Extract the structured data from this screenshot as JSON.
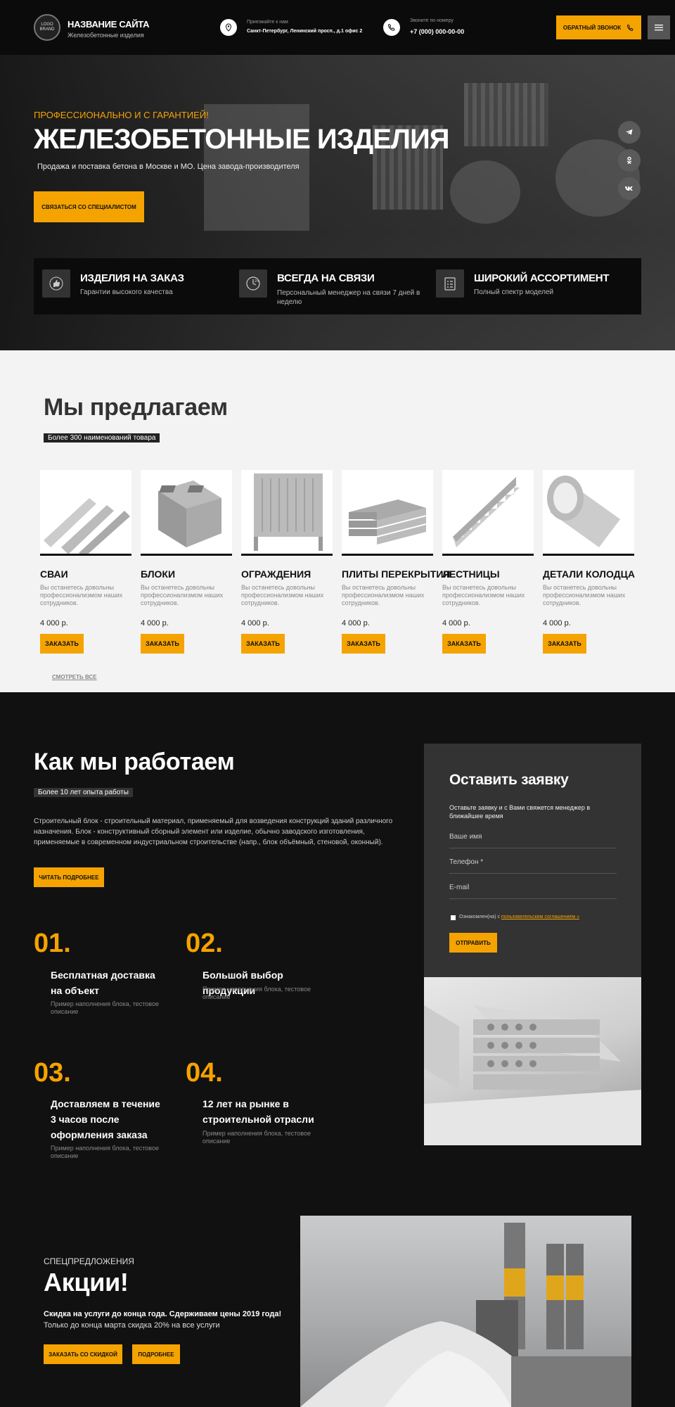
{
  "header": {
    "logo_line1": "LOGO",
    "logo_line2": "BRAND",
    "site_name": "НАЗВАНИЕ САЙТА",
    "site_subtitle": "Железобетонные изделия",
    "address_label": "Приезжайте к нам",
    "address": "Санкт-Петербург, Ленинский просп., д.1 офис 2",
    "phone_label": "Звоните по номеру",
    "phone": "+7 (000) 000-00-00",
    "callback_button": "ОБРАТНЫЙ ЗВОНОК",
    "icons": [
      "map-pin-icon",
      "phone-icon",
      "menu-icon"
    ]
  },
  "hero": {
    "eyebrow": "ПРОФЕССИОНАЛЬНО И С ГАРАНТИЕЙ!",
    "title": "ЖЕЛЕЗОБЕТОННЫЕ ИЗДЕЛИЯ",
    "subtitle": "Продажа и поставка бетона в Москве и МО. Цена завода-производителя",
    "cta": "СВЯЗАТЬСЯ СО СПЕЦИАЛИСТОМ",
    "social": [
      "telegram-icon",
      "odnoklassniki-icon",
      "vk-icon"
    ],
    "features": [
      {
        "title": "ИЗДЕЛИЯ НА ЗАКАЗ",
        "desc": "Гарантии высокого качества",
        "icon": "thumbs-up-icon"
      },
      {
        "title": "ВСЕГДА НА СВЯЗИ",
        "desc": "Персональный менеджер на связи 7 дней в неделю",
        "icon": "clock-24-icon"
      },
      {
        "title": "ШИРОКИЙ АССОРТИМЕНТ",
        "desc": "Полный спектр моделей",
        "icon": "checklist-icon"
      }
    ]
  },
  "offer": {
    "title": "Мы предлагаем",
    "badge": "Более 300 наименований товара",
    "products": [
      {
        "name": "СВАИ",
        "desc": "Вы останетесь довольны профессионализмом наших сотрудников.",
        "price": "4 000 р.",
        "button": "ЗАКАЗАТЬ"
      },
      {
        "name": "БЛОКИ",
        "desc": "Вы останетесь довольны профессионализмом наших сотрудников.",
        "price": "4 000 р.",
        "button": "ЗАКАЗАТЬ"
      },
      {
        "name": "ОГРАЖДЕНИЯ",
        "desc": "Вы останетесь довольны профессионализмом наших сотрудников.",
        "price": "4 000 р.",
        "button": "ЗАКАЗАТЬ"
      },
      {
        "name": "ПЛИТЫ ПЕРЕКРЫТИЯ",
        "desc": "Вы останетесь довольны профессионализмом наших сотрудников.",
        "price": "4 000 р.",
        "button": "ЗАКАЗАТЬ"
      },
      {
        "name": "ЛЕСТНИЦЫ",
        "desc": "Вы останетесь довольны профессионализмом наших сотрудников.",
        "price": "4 000 р.",
        "button": "ЗАКАЗАТЬ"
      },
      {
        "name": "ДЕТАЛИ КОЛОДЦА",
        "desc": "Вы останетесь довольны профессионализмом наших сотрудников.",
        "price": "4 000 р.",
        "button": "ЗАКАЗАТЬ"
      }
    ],
    "see_all": "СМОТРЕТЬ ВСЕ"
  },
  "work": {
    "title": "Как мы работаем",
    "badge": "Более 10 лет опыта работы",
    "text": "Строительный блок - строительный материал, применяемый для возведения конструкций зданий различного назначения. Блок - конструктивный сборный элемент или изделие, обычно заводского изготовления, применяемые в современном индустриальном строительстве (напр., блок объёмный, стеновой, оконный).",
    "more_button": "ЧИТАТЬ ПОДРОБНЕЕ",
    "steps": [
      {
        "num": "01.",
        "title": "Бесплатная доставка на объект",
        "desc": "Пример наполнения блока, тестовое описание"
      },
      {
        "num": "02.",
        "title": "Большой выбор продукции",
        "desc": "Пример наполнения блока, тестовое описание"
      },
      {
        "num": "03.",
        "title": "Доставляем в течение 3 часов после оформления заказа",
        "desc": "Пример наполнения блока, тестовое описание"
      },
      {
        "num": "04.",
        "title": "12 лет на рынке в строительной отрасли",
        "desc": "Пример наполнения блока, тестовое описание"
      }
    ]
  },
  "form": {
    "title": "Оставить заявку",
    "subtitle": "Оставьте заявку и с Вами свяжется менеджер в ближайшее время",
    "name_placeholder": "Ваше имя",
    "phone_placeholder": "Телефон *",
    "email_placeholder": "E-mail",
    "consent_prefix": "Ознакомлен(на) с",
    "consent_link": "пользовательским соглашением »",
    "submit": "ОТПРАВИТЬ"
  },
  "promo": {
    "eyebrow": "СПЕЦПРЕДЛОЖЕНИЯ",
    "title": "Акции!",
    "line1": "Скидка на услуги до конца года. Сдерживаем цены 2019 года!",
    "line2": "Только до конца марта скидка 20% на все услуги",
    "button1": "ЗАКАЗАТЬ СО СКИДКОЙ",
    "button2": "ПОДРОБНЕЕ"
  },
  "colors": {
    "accent": "#f5a300",
    "dark": "#111111",
    "light": "#f3f3f3"
  }
}
